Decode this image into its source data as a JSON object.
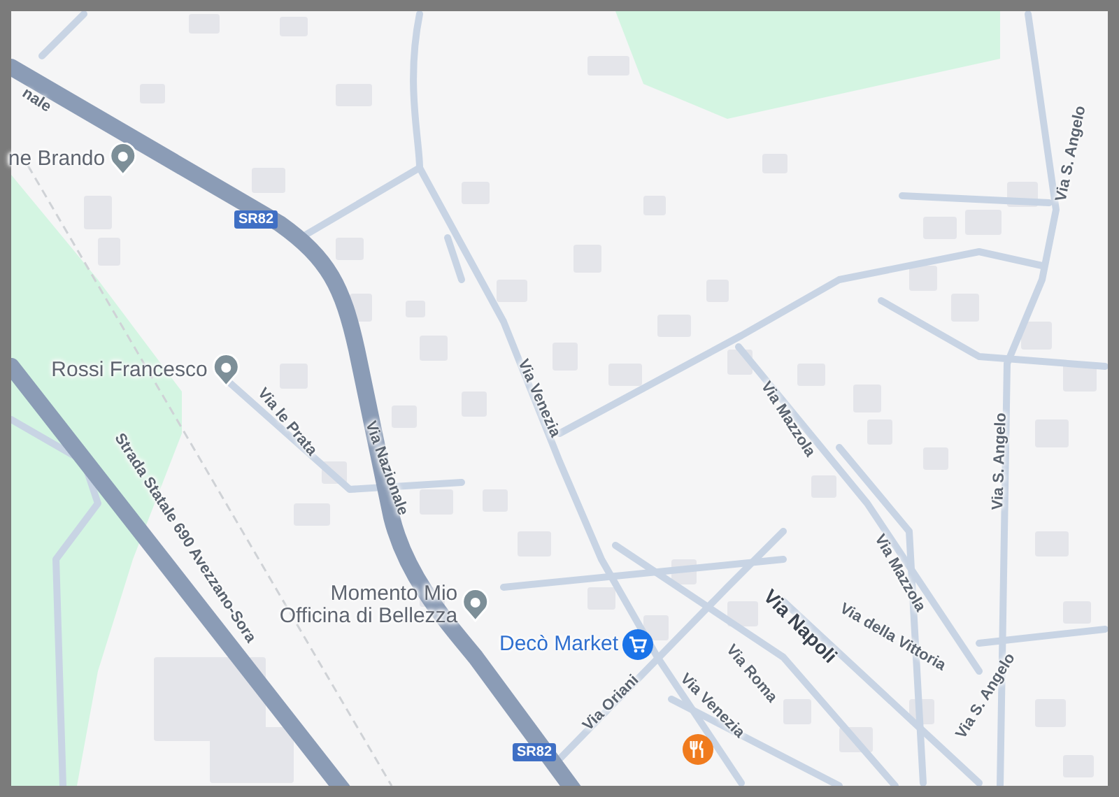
{
  "map": {
    "labels": [
      {
        "kind": "street",
        "text": "nale"
      },
      {
        "kind": "place",
        "lines": [
          "ne Brando"
        ]
      },
      {
        "kind": "shield",
        "text": "SR82"
      },
      {
        "kind": "place",
        "lines": [
          "Rossi Francesco"
        ]
      },
      {
        "kind": "street",
        "text": "Via le Prata"
      },
      {
        "kind": "street",
        "text": "Via Nazionale"
      },
      {
        "kind": "street",
        "text": "Via Venezia"
      },
      {
        "kind": "street",
        "text": "Strada Statale 690 Avezzano-Sora"
      },
      {
        "kind": "place",
        "lines": [
          "Momento Mio",
          "Officina di Bellezza"
        ]
      },
      {
        "kind": "shop",
        "lines": [
          "Decò Market"
        ]
      },
      {
        "kind": "shield",
        "text": "SR82"
      },
      {
        "kind": "street",
        "text": "Via Oriani"
      },
      {
        "kind": "street",
        "text": "Via Venezia"
      },
      {
        "kind": "street",
        "text": "Via Roma"
      },
      {
        "kind": "major",
        "text": "Via Napoli"
      },
      {
        "kind": "street",
        "text": "Via della Vittoria"
      },
      {
        "kind": "street",
        "text": "Via Mazzola"
      },
      {
        "kind": "street",
        "text": "Via Mazzola"
      },
      {
        "kind": "street",
        "text": "Via S. Angelo"
      },
      {
        "kind": "street",
        "text": "Via S. Angelo"
      },
      {
        "kind": "street",
        "text": "Via S. Angelo"
      }
    ]
  }
}
